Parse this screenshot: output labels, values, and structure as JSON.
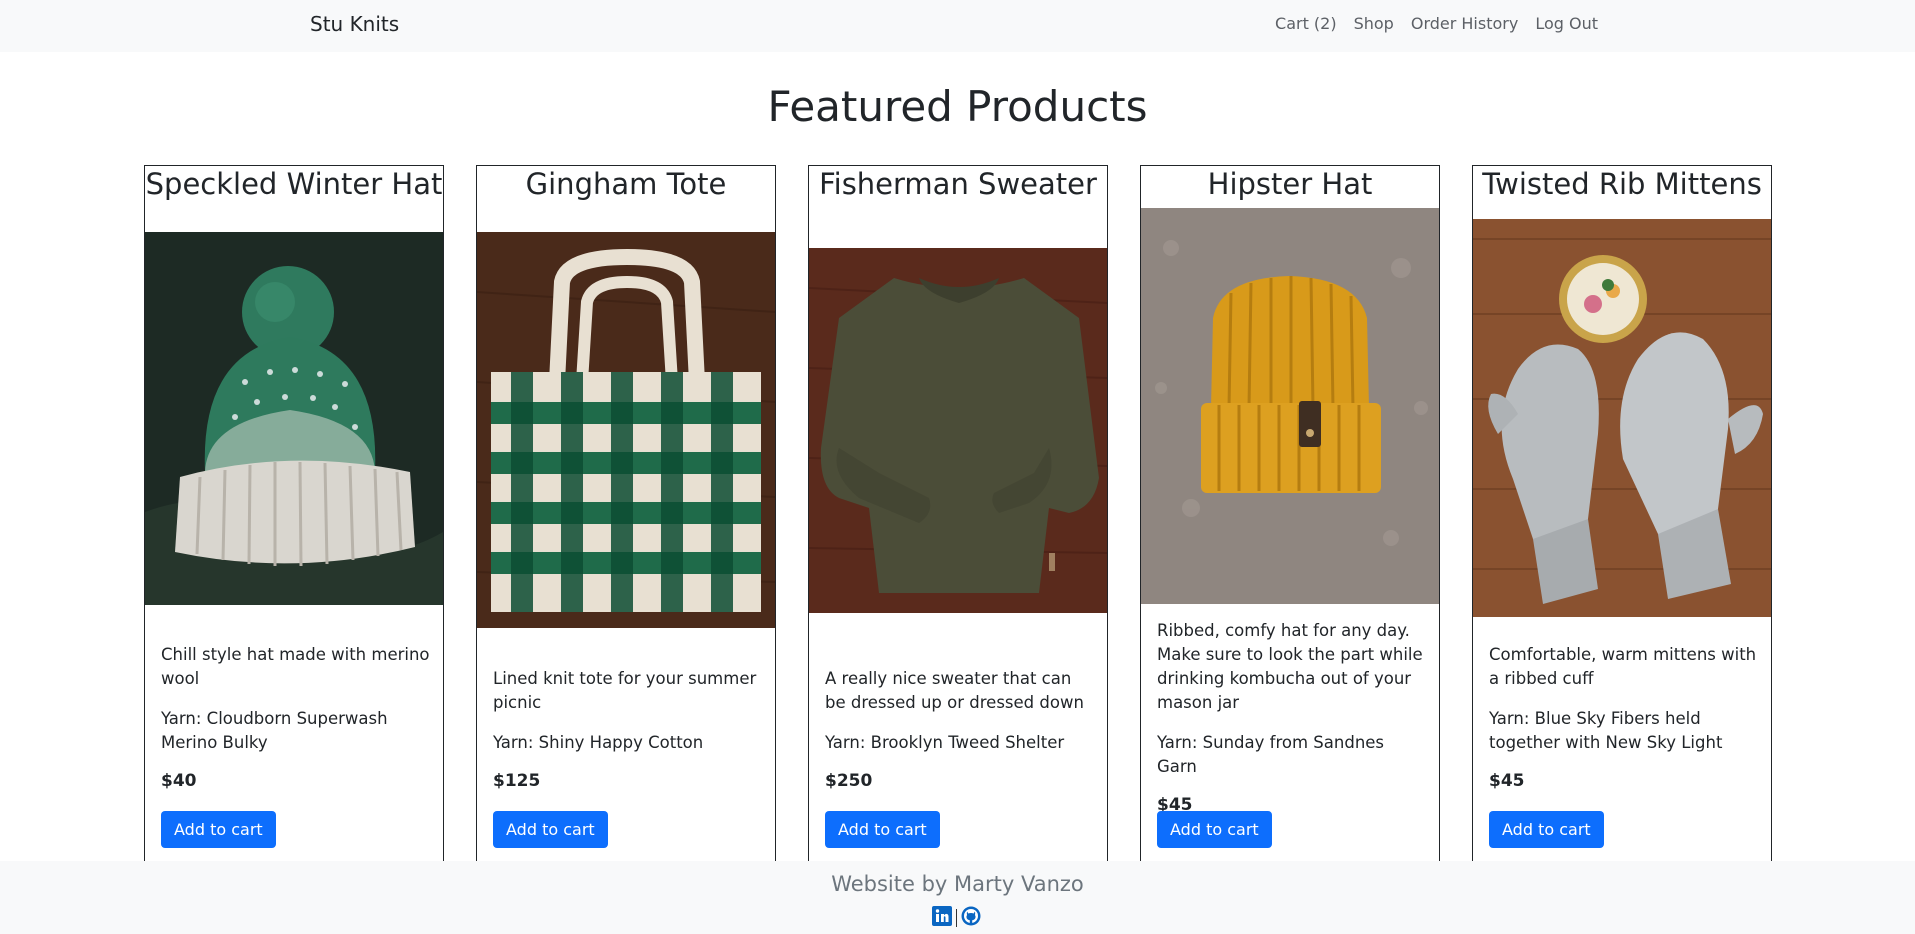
{
  "navbar": {
    "brand": "Stu Knits",
    "links": [
      {
        "label": "Cart (2)"
      },
      {
        "label": "Shop"
      },
      {
        "label": "Order History"
      },
      {
        "label": "Log Out"
      }
    ]
  },
  "page_title": "Featured Products",
  "products": [
    {
      "title": "Speckled Winter Hat",
      "description": "Chill style hat made with merino wool",
      "yarn": "Yarn: Cloudborn Superwash Merino Bulky",
      "price": "$40",
      "button": "Add to cart",
      "image": "green-white-pompom-beanie"
    },
    {
      "title": "Gingham Tote",
      "description": "Lined knit tote for your summer picnic",
      "yarn": "Yarn: Shiny Happy Cotton",
      "price": "$125",
      "button": "Add to cart",
      "image": "green-cream-gingham-tote"
    },
    {
      "title": "Fisherman Sweater",
      "description": "A really nice sweater that can be dressed up or dressed down",
      "yarn": "Yarn: Brooklyn Tweed Shelter",
      "price": "$250",
      "button": "Add to cart",
      "image": "olive-knit-sweater"
    },
    {
      "title": "Hipster Hat",
      "description": "Ribbed, comfy hat for any day. Make sure to look the part while drinking kombucha out of your mason jar",
      "yarn": "Yarn: Sunday from Sandnes Garn",
      "price": "$45",
      "button": "Add to cart",
      "image": "mustard-ribbed-beanie"
    },
    {
      "title": "Twisted Rib Mittens",
      "description": "Comfortable, warm mittens with a ribbed cuff",
      "yarn": "Yarn: Blue Sky Fibers held together with New Sky Light",
      "price": "$45",
      "button": "Add to cart",
      "image": "grey-ribbed-mittens"
    }
  ],
  "footer": {
    "text": "Website by Marty Vanzo",
    "icons": [
      "linkedin-icon",
      "github-icon"
    ]
  },
  "colors": {
    "navbar_bg": "#f8f9fa",
    "button_bg": "#0d6efd",
    "footer_text": "#6c757d"
  }
}
